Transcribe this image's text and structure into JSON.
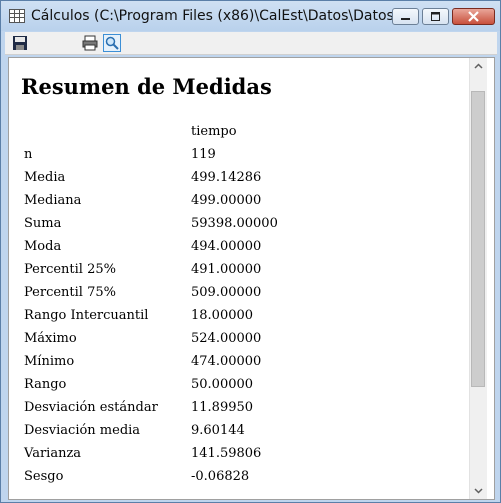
{
  "window": {
    "title": "Cálculos (C:\\Program Files (x86)\\CalEst\\Datos\\Datos..."
  },
  "toolbar": {
    "save_icon": "floppy-disk-icon",
    "print_icon": "printer-icon",
    "preview_icon": "print-preview-magnifier-icon"
  },
  "report": {
    "heading": "Resumen de Medidas",
    "column_header": "tiempo",
    "rows": [
      {
        "label": "n",
        "value": "119"
      },
      {
        "label": "Media",
        "value": "499.14286"
      },
      {
        "label": "Mediana",
        "value": "499.00000"
      },
      {
        "label": "Suma",
        "value": "59398.00000"
      },
      {
        "label": "Moda",
        "value": "494.00000"
      },
      {
        "label": "Percentil 25%",
        "value": "491.00000"
      },
      {
        "label": "Percentil 75%",
        "value": "509.00000"
      },
      {
        "label": "Rango Intercuantil",
        "value": "18.00000"
      },
      {
        "label": "Máximo",
        "value": "524.00000"
      },
      {
        "label": "Mínimo",
        "value": "474.00000"
      },
      {
        "label": "Rango",
        "value": "50.00000"
      },
      {
        "label": "Desviación estándar",
        "value": "11.89950"
      },
      {
        "label": "Desviación media",
        "value": "9.60144"
      },
      {
        "label": "Varianza",
        "value": "141.59806"
      },
      {
        "label": "Sesgo",
        "value": "-0.06828"
      }
    ]
  },
  "colors": {
    "titlebar": "#bfd5ee",
    "close_button": "#c8503c"
  }
}
